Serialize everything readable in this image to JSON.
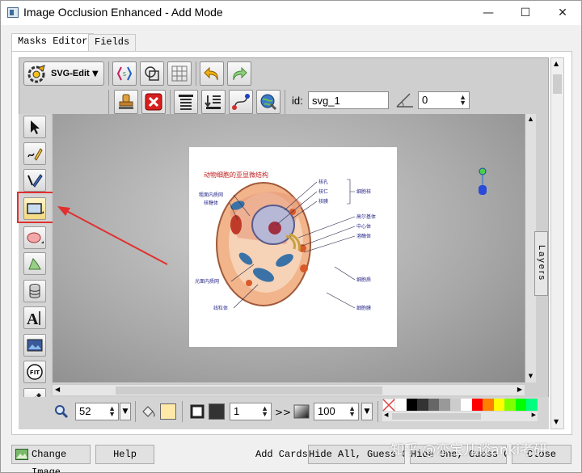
{
  "window": {
    "title": "Image Occlusion Enhanced - Add Mode",
    "minimize": "—",
    "maximize": "☐",
    "close": "✕"
  },
  "tabs": [
    {
      "label": "Masks Editor",
      "active": true
    },
    {
      "label": "Fields",
      "active": false
    }
  ],
  "toolbar": {
    "svg_edit_label": "SVG-Edit",
    "id_label": "id:",
    "id_value": "svg_1",
    "angle_value": "0"
  },
  "bottom": {
    "zoom_value": "52",
    "stroke_width_value": "1",
    "opacity_value": "100",
    "fill_color": "#ffe8a8",
    "stroke_color": "#333333",
    "palette": [
      "#ffffff",
      "#000000",
      "#333333",
      "#666666",
      "#999999",
      "#cccccc",
      "#ffffff",
      "#ff0000",
      "#ff7f00",
      "#ffff00",
      "#7fff00",
      "#00ff00",
      "#00ff7f"
    ]
  },
  "image": {
    "title": "动物细胞的亚显微结构",
    "labels_right": [
      "核孔",
      "核仁",
      "核膜",
      "细胞核",
      "高尔基体",
      "中心体",
      "溶酶体",
      "细胞质",
      "细胞膜"
    ],
    "labels_left": [
      "粗面内质网",
      "核糖体",
      "光面内质网",
      "线粒体"
    ]
  },
  "layers_label": "Layers",
  "footer": {
    "change_image": "Change Image",
    "help": "Help",
    "add_cards_label": "Add Cards:",
    "hide_all": "Hide All, Guess One",
    "hide_one": "Hide One, Guess One",
    "close": "Close"
  },
  "watermark": "知乎 @恋宝儿谈anki考研",
  "colors": {
    "highlight": "#e03030",
    "arrow": "#e03030"
  }
}
